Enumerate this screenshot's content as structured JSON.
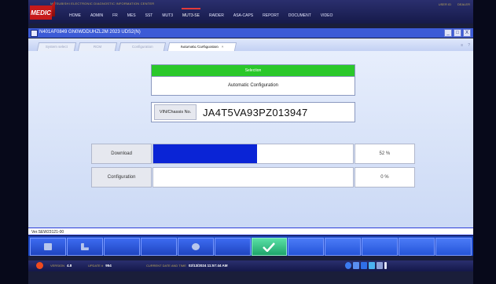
{
  "app": {
    "brand_strip": "MITSUBISHI ELECTRONIC DIAGNOSTIC INFORMATION CENTER",
    "logo_text": "MEDIC",
    "nav": [
      "HOME",
      "ADMIN",
      "FR",
      "MES",
      "SST",
      "MUT3",
      "MUT3-SE",
      "RAIDER",
      "ASA-CAPS",
      "REPORT",
      "DOCUMENT",
      "VIDEO"
    ],
    "active_nav": "MUT3-SE",
    "user_links": [
      "USER ID",
      "DEALER"
    ]
  },
  "window": {
    "title": "N401AF0849  GN0WDDUHZL2M 2023  UDS2(N)",
    "buttons": [
      "_",
      "□",
      "X"
    ]
  },
  "tabs": [
    "System select",
    "RCM",
    "Configuration",
    "Automatic Configuration"
  ],
  "active_tab": "Automatic Configuration",
  "tab_close": "×",
  "tab_right": [
    "≡",
    "?"
  ],
  "selection": {
    "header": "Selection",
    "value": "Automatic Configuration"
  },
  "vin": {
    "label": "VIN/Chassis No.",
    "value": "JA4T5VA93PZ013947"
  },
  "progress": [
    {
      "label": "Download",
      "percent_text": "52 %",
      "fraction": 0.52
    },
    {
      "label": "Configuration",
      "percent_text": "0 %",
      "fraction": 0
    }
  ],
  "status_line": "Ver.SEW23121-00",
  "toolbar": {
    "buttons": [
      "folder-icon",
      "back-icon",
      "",
      "",
      "db-icon",
      "",
      "check-icon",
      "",
      "",
      "",
      "",
      ""
    ]
  },
  "taskbar": {
    "version_label": "VERSION",
    "version_value": "4.8",
    "update_label": "UPDATE #",
    "update_value": "954",
    "datetime_label": "CURRENT DATE AND TIME",
    "datetime_value": "02/13/2024 11:57:44 AM"
  },
  "colors": {
    "accent": "#0a24d6",
    "selection_header": "#2ac82a",
    "brand_red": "#c61a1a"
  }
}
